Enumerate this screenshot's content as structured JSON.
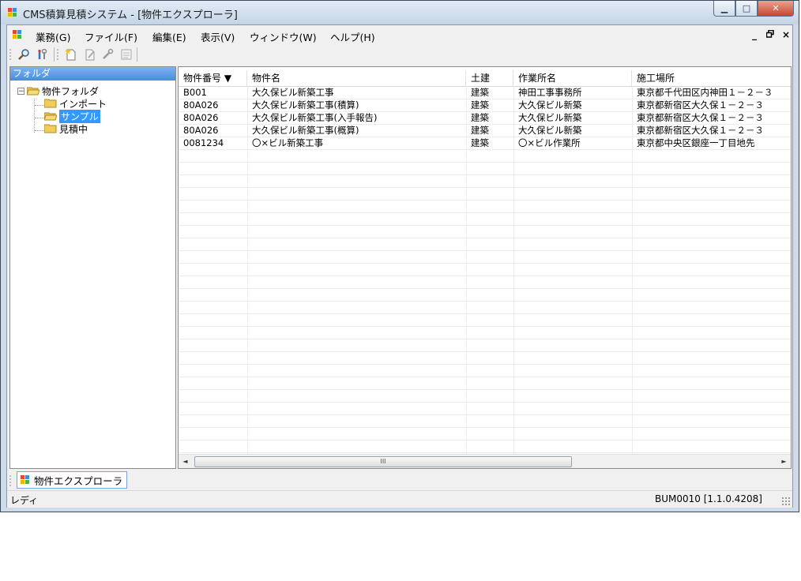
{
  "window": {
    "title": "CMS積算見積システム - [物件エクスプローラ]",
    "controls": {
      "minimize": "▁",
      "maximize": "□",
      "close": "✕"
    }
  },
  "menu": {
    "items": [
      "業務(G)",
      "ファイル(F)",
      "編集(E)",
      "表示(V)",
      "ウィンドウ(W)",
      "ヘルプ(H)"
    ],
    "mdi_min": "_",
    "mdi_restore": "🗗",
    "mdi_close": "×"
  },
  "toolbar": {
    "icons": [
      "search-icon",
      "tools-icon",
      "new-document-icon",
      "edit-document-icon",
      "wrench-icon",
      "properties-icon"
    ]
  },
  "folder_pane": {
    "header": "フォルダ",
    "tree": {
      "root": {
        "label": "物件フォルダ",
        "expander": "−"
      },
      "children": [
        {
          "label": "インポート",
          "selected": false
        },
        {
          "label": "サンプル",
          "selected": true
        },
        {
          "label": "見積中",
          "selected": false
        }
      ]
    }
  },
  "grid": {
    "columns": [
      "物件番号 ▼",
      "物件名",
      "土建",
      "作業所名",
      "施工場所"
    ],
    "rows": [
      [
        "B001",
        "大久保ビル新築工事",
        "建築",
        "神田工事事務所",
        "東京都千代田区内神田１－２－３"
      ],
      [
        "80A026",
        "大久保ビル新築工事(積算)",
        "建築",
        "大久保ビル新築",
        "東京都新宿区大久保１－２－３"
      ],
      [
        "80A026",
        "大久保ビル新築工事(入手報告)",
        "建築",
        "大久保ビル新築",
        "東京都新宿区大久保１－２－３"
      ],
      [
        "80A026",
        "大久保ビル新築工事(概算)",
        "建築",
        "大久保ビル新築",
        "東京都新宿区大久保１－２－３"
      ],
      [
        "0081234",
        "〇×ビル新築工事",
        "建築",
        "〇×ビル作業所",
        "東京都中央区銀座一丁目地先"
      ]
    ],
    "scroll_left": "◄",
    "scroll_right": "►",
    "scroll_thumb": "III"
  },
  "doc_tab": {
    "label": "物件エクスプローラ"
  },
  "status": {
    "left": "レディ",
    "right": "BUM0010 [1.1.0.4208]"
  }
}
